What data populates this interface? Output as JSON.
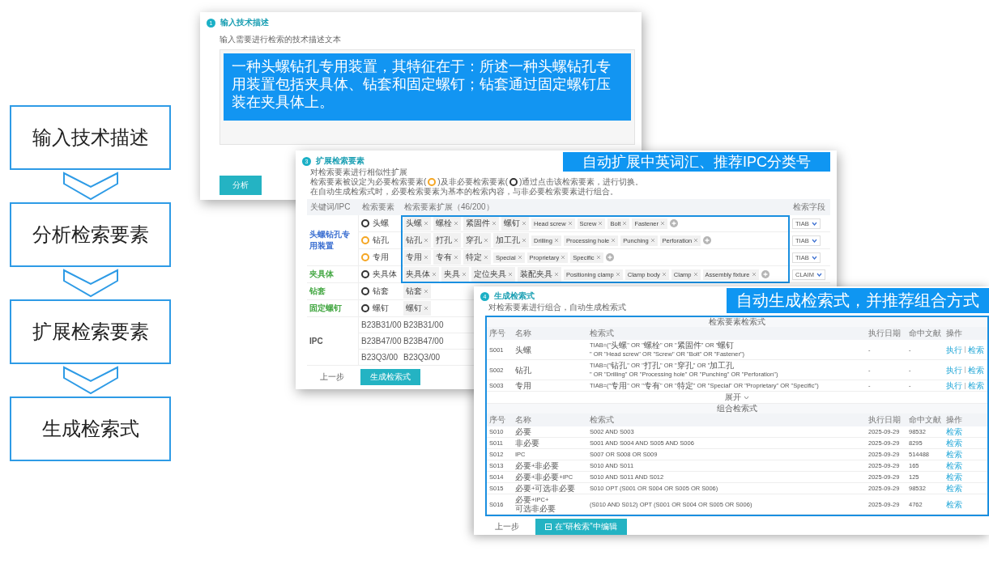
{
  "flow": [
    "输入技术描述",
    "分析检索要素",
    "扩展检索要素",
    "生成检索式"
  ],
  "input_panel": {
    "step": "1",
    "title": "输入技术描述",
    "subtitle": "输入需要进行检索的技术描述文本",
    "description": "一种头螺钻孔专用装置，其特征在于：所述一种头螺钻孔专用装置包括夹具体、钻套和固定螺钉；钻套通过固定螺钉压装在夹具体上。",
    "button": "分析"
  },
  "expand_panel": {
    "step": "3",
    "title": "扩展检索要素",
    "callout": "自动扩展中英词汇、推荐IPC分类号",
    "intro": "对检索要素进行相似性扩展",
    "legend": [
      {
        "kind": "text",
        "text": "检索要素被设定为必要检索要素("
      },
      {
        "kind": "ring",
        "required": true
      },
      {
        "kind": "text",
        "text": ")及非必要检索要素("
      },
      {
        "kind": "ring",
        "required": false
      },
      {
        "kind": "text",
        "text": ")通过点击该检索要素，进行切换。"
      }
    ],
    "note": "在自动生成检索式时，必要检索要素为基本的检索内容，与非必要检索要素进行组合。",
    "columns": [
      "关键词/IPC",
      "检索要素",
      "检索要素扩展（46/200）",
      "检索字段"
    ],
    "groups": [
      {
        "keyword": "头螺钻孔专用装置",
        "color": "#3b6fd1",
        "rows": [
          {
            "element": "头螺",
            "kind": "element",
            "required": false,
            "highlighted": true,
            "tags": [
              "头螺",
              "螺栓",
              "紧固件",
              "螺钉",
              "Head screw",
              "Screw",
              "Bolt",
              "Fastener"
            ],
            "field": "TIAB"
          },
          {
            "element": "钻孔",
            "kind": "element",
            "required": true,
            "highlighted": true,
            "tags": [
              "钻孔",
              "打孔",
              "穿孔",
              "加工孔",
              "Drilling",
              "Processing hole",
              "Punching",
              "Perforation"
            ],
            "field": "TIAB"
          },
          {
            "element": "专用",
            "kind": "element",
            "required": true,
            "highlighted": true,
            "tags": [
              "专用",
              "专有",
              "特定",
              "Special",
              "Proprietary",
              "Specific"
            ],
            "field": "TIAB"
          }
        ]
      },
      {
        "keyword": "夹具体",
        "color": "#45a844",
        "rows": [
          {
            "element": "夹具体",
            "kind": "element",
            "required": false,
            "highlighted": true,
            "tags": [
              "夹具体",
              "夹具",
              "定位夹具",
              "装配夹具",
              "Positioning clamp",
              "Clamp body",
              "Clamp",
              "Assembly fixture"
            ],
            "field": "CLAIM"
          }
        ]
      },
      {
        "keyword": "钻套",
        "color": "#45a844",
        "rows": [
          {
            "element": "钻套",
            "kind": "element",
            "required": false,
            "highlighted": false,
            "tags": [
              "钻套"
            ]
          }
        ]
      },
      {
        "keyword": "固定螺钉",
        "color": "#45a844",
        "rows": [
          {
            "element": "螺钉",
            "kind": "element",
            "required": false,
            "highlighted": false,
            "tags": [
              "螺钉"
            ]
          }
        ]
      },
      {
        "keyword": "IPC",
        "color": "#555555",
        "rows": [
          {
            "element": "B23B31/00",
            "kind": "ipc",
            "tags": [],
            "text": "B23B31/00"
          },
          {
            "element": "B23B47/00",
            "kind": "ipc",
            "tags": [],
            "text": "B23B47/00"
          },
          {
            "element": "B23Q3/00",
            "kind": "ipc",
            "tags": [],
            "text": "B23Q3/00"
          }
        ]
      }
    ],
    "buttons": [
      {
        "label": "上一步",
        "primary": false
      },
      {
        "label": "生成检索式",
        "primary": true
      }
    ]
  },
  "formula_panel": {
    "step": "4",
    "title": "生成检索式",
    "subtitle": "对检索要素进行组合，自动生成检索式",
    "callout": "自动生成检索式，并推荐组合方式",
    "sections": [
      {
        "title": "检索要素检索式",
        "columns": [
          "序号",
          "名称",
          "检索式",
          "执行日期",
          "命中文献",
          "操作"
        ],
        "rows": [
          {
            "id": "S001",
            "name": "头螺",
            "formula": "TIAB=(\"头螺\" OR \"螺栓\" OR \"紧固件\" OR \"螺钉\" OR \"Head screw\" OR \"Screw\" OR \"Bolt\" OR \"Fastener\")",
            "date": "-",
            "hits": "-",
            "actions": [
              "执行",
              "检索"
            ]
          },
          {
            "id": "S002",
            "name": "钻孔",
            "formula": "TIAB=(\"钻孔\" OR \"打孔\" OR \"穿孔\" OR \"加工孔\" OR \"Drilling\" OR \"Processing hole\" OR \"Punching\" OR \"Perforation\")",
            "date": "-",
            "hits": "-",
            "actions": [
              "执行",
              "检索"
            ]
          },
          {
            "id": "S003",
            "name": "专用",
            "formula": "TIAB=(\"专用\" OR \"专有\" OR \"特定\" OR \"Special\" OR \"Proprietary\" OR \"Specific\")",
            "date": "-",
            "hits": "-",
            "actions": [
              "执行",
              "检索"
            ]
          }
        ],
        "expand": "展开"
      },
      {
        "title": "组合检索式",
        "columns": [
          "序号",
          "名称",
          "检索式",
          "执行日期",
          "命中文献",
          "操作"
        ],
        "rows": [
          {
            "id": "S010",
            "name": "必要",
            "formula": "S002 AND S003",
            "date": "2025-09-29",
            "hits": "98532",
            "actions": [
              "检索"
            ]
          },
          {
            "id": "S011",
            "name": "非必要",
            "formula": "S001 AND S004 AND S005 AND S006",
            "date": "2025-09-29",
            "hits": "8295",
            "actions": [
              "检索"
            ]
          },
          {
            "id": "S012",
            "name": "IPC",
            "formula": "S007 OR S008 OR S009",
            "date": "2025-09-29",
            "hits": "514488",
            "actions": [
              "检索"
            ]
          },
          {
            "id": "S013",
            "name": "必要+非必要",
            "formula": "S010 AND S011",
            "date": "2025-09-29",
            "hits": "165",
            "actions": [
              "检索"
            ]
          },
          {
            "id": "S014",
            "name": "必要+非必要+IPC",
            "formula": "S010 AND S011 AND S012",
            "date": "2025-09-29",
            "hits": "125",
            "actions": [
              "检索"
            ]
          },
          {
            "id": "S015",
            "name": "必要+可选非必要",
            "formula": "S010 OPT (S001 OR S004 OR S005 OR S006)",
            "date": "2025-09-29",
            "hits": "98532",
            "actions": [
              "检索"
            ]
          },
          {
            "id": "S016",
            "name": "必要+IPC+可选非必要",
            "formula": "(S010 AND S012) OPT (S001 OR S004 OR S005 OR S006)",
            "date": "2025-09-29",
            "hits": "4762",
            "actions": [
              "检索"
            ]
          }
        ]
      }
    ],
    "buttons": [
      {
        "label": "上一步",
        "kind": "back"
      },
      {
        "label": "在“研检索”中编辑",
        "kind": "edit"
      }
    ]
  }
}
